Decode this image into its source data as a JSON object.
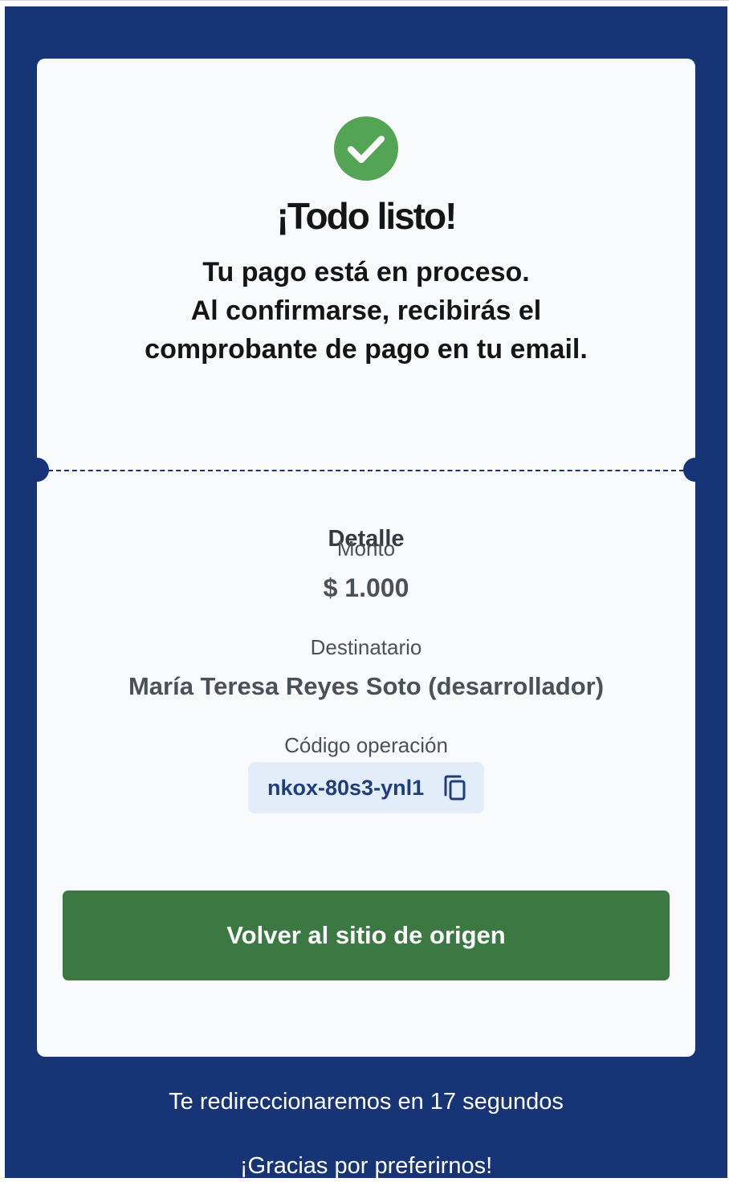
{
  "colors": {
    "background": "#163476",
    "card": "#f8fafc",
    "success": "#53a455",
    "button": "#3b7842",
    "code_chip": "#e3edf9",
    "code_text": "#1f3e7a"
  },
  "confirmation": {
    "icon": "check-circle-icon",
    "title": "¡Todo listo!",
    "message_lines": [
      "Tu pago está en proceso.",
      "Al confirmarse, recibirás el",
      "comprobante de pago en tu email."
    ]
  },
  "detail": {
    "heading": "Detalle",
    "amount_label": "Monto",
    "amount_value": "$ 1.000",
    "recipient_label": "Destinatario",
    "recipient_value": "María Teresa Reyes Soto (desarrollador)",
    "code_label": "Código operación",
    "code_value": "nkox-80s3-ynl1",
    "copy_icon": "copy-icon"
  },
  "actions": {
    "back_button_label": "Volver al sitio de origen"
  },
  "footer": {
    "redirect_text": "Te redireccionaremos en 17 segundos",
    "thanks_text": "¡Gracias por preferirnos!"
  }
}
